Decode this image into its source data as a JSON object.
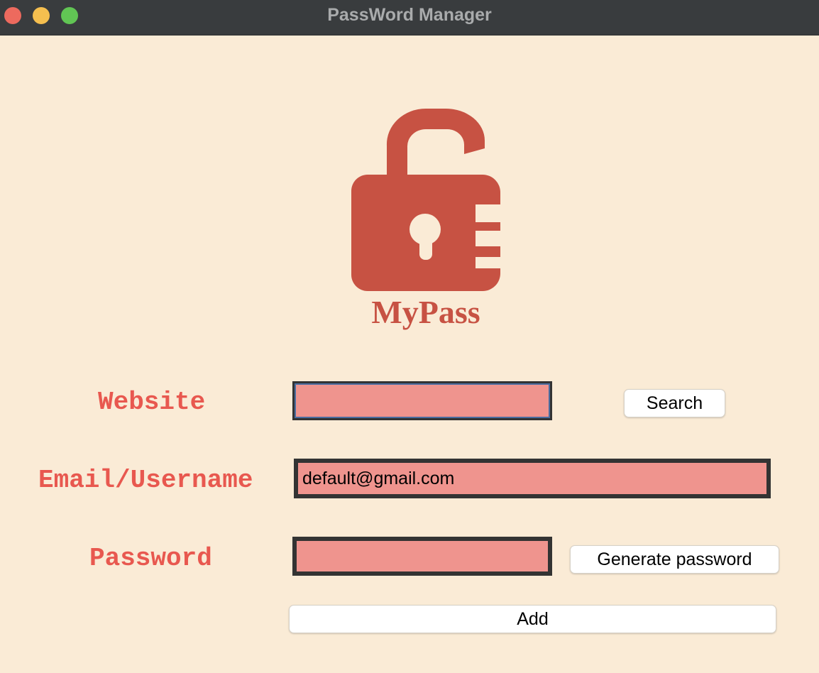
{
  "window": {
    "title": "PassWord Manager"
  },
  "logo": {
    "text": "MyPass",
    "color": "#c75243"
  },
  "form": {
    "website": {
      "label": "Website",
      "value": ""
    },
    "email": {
      "label": "Email/Username",
      "value": "default@gmail.com"
    },
    "password": {
      "label": "Password",
      "value": ""
    }
  },
  "buttons": {
    "search": "Search",
    "generate": "Generate password",
    "add": "Add"
  },
  "colors": {
    "background": "#faebd6",
    "label": "#e8584f",
    "entry_fill": "#ef948e"
  }
}
